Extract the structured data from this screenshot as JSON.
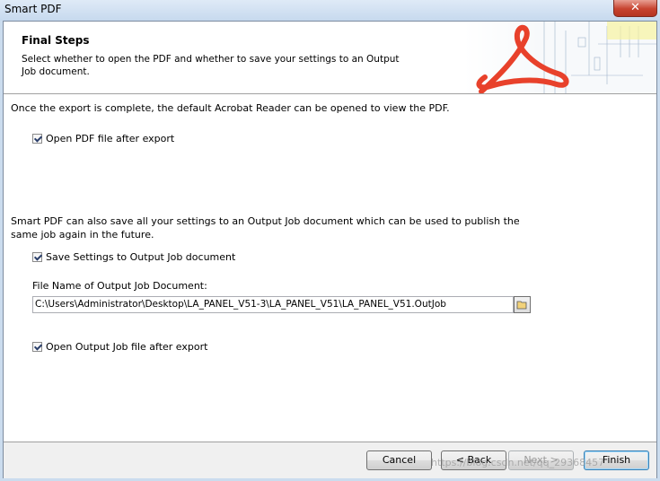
{
  "window": {
    "title": "Smart PDF",
    "close_label": "✕"
  },
  "header": {
    "title": "Final Steps",
    "subtitle": "Select whether to open the PDF and whether to save your settings to an Output Job document."
  },
  "body": {
    "intro": "Once the export is complete, the default Acrobat Reader can be opened to view the PDF.",
    "open_pdf": {
      "label": "Open PDF file after export",
      "checked": true
    },
    "save_info": "Smart PDF can also save all your settings to an Output Job document which can be used to publish the same job again in the future.",
    "save_settings": {
      "label": "Save Settings to Output Job document",
      "checked": true
    },
    "file_name_label": "File Name of Output Job Document:",
    "file_path": "C:\\Users\\Administrator\\Desktop\\LA_PANEL_V51-3\\LA_PANEL_V51\\LA_PANEL_V51.OutJob",
    "open_outjob": {
      "label": "Open Output Job file after export",
      "checked": true
    }
  },
  "footer": {
    "cancel": "Cancel",
    "back": "< Back",
    "next": "Next >",
    "finish": "Finish"
  },
  "watermark": "https://blog.csdn.net/qq_29368457",
  "colors": {
    "acrobat_red": "#e8412b",
    "titlebar": "#cbdcee",
    "close": "#c7432f"
  }
}
